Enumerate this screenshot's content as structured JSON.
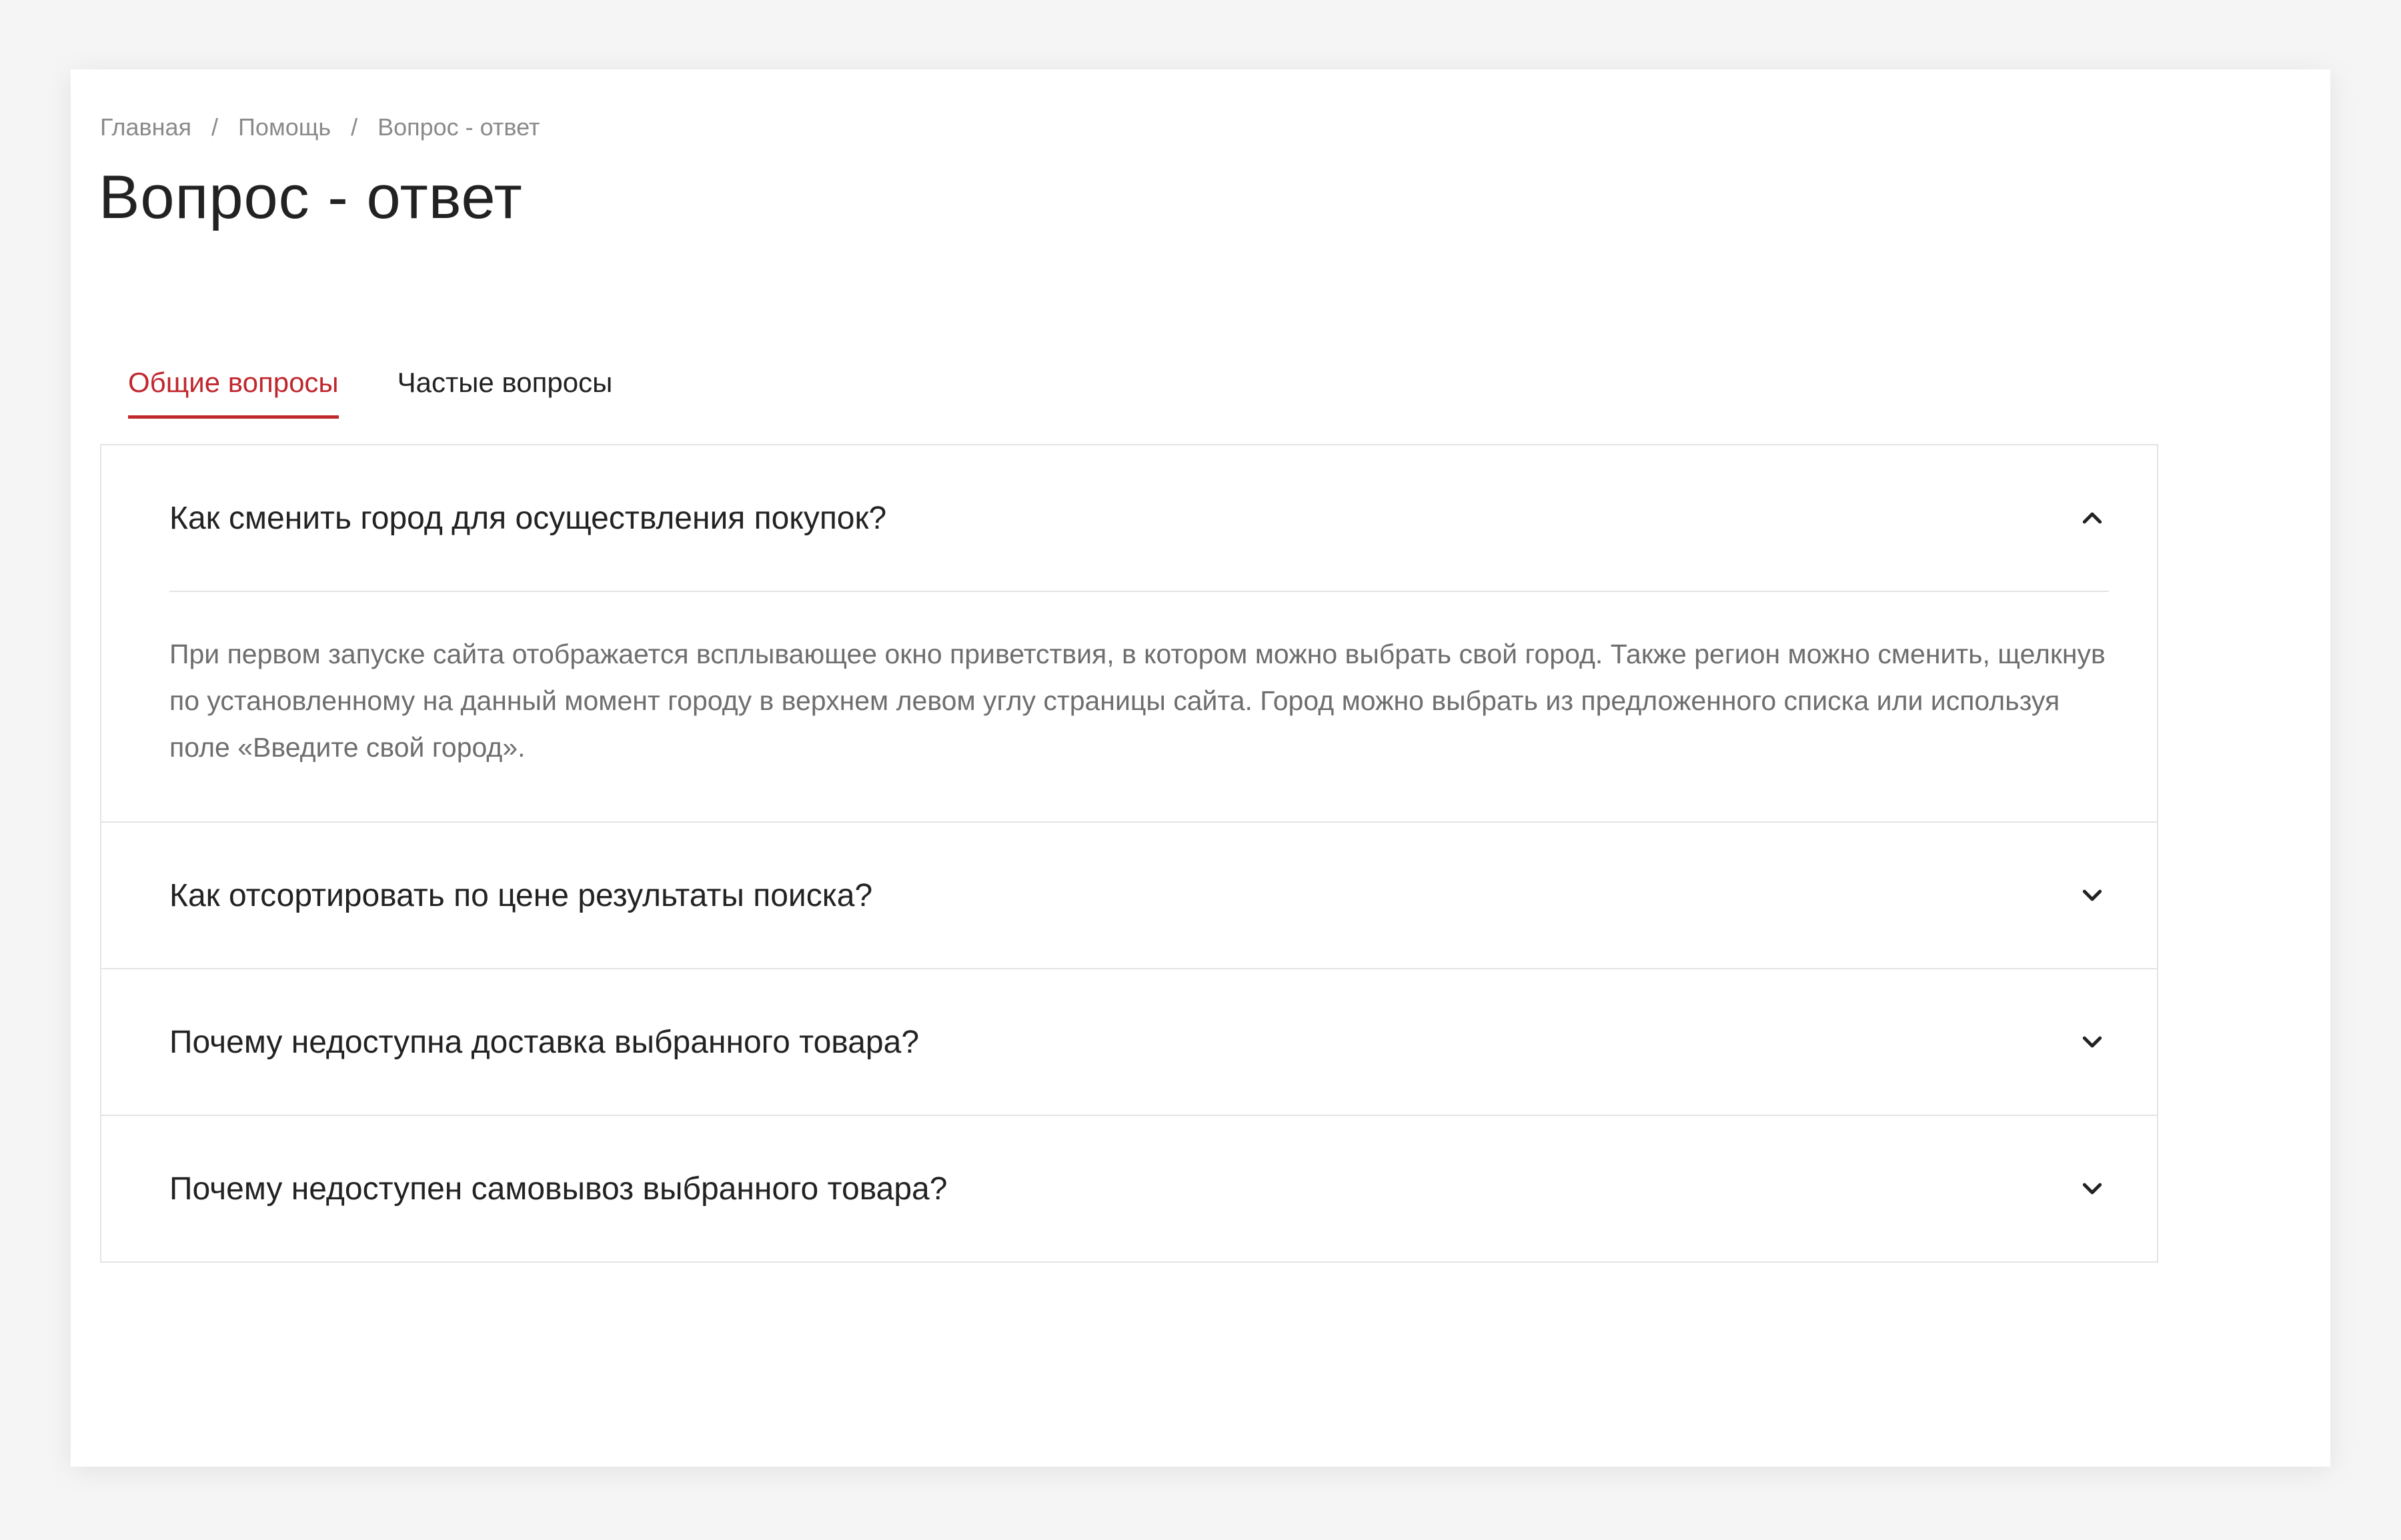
{
  "breadcrumb": {
    "items": [
      "Главная",
      "Помощь",
      "Вопрос - ответ"
    ],
    "separator": "/"
  },
  "page": {
    "title": "Вопрос - ответ"
  },
  "tabs": [
    {
      "label": "Общие вопросы",
      "active": true
    },
    {
      "label": "Частые вопросы",
      "active": false
    }
  ],
  "faq": [
    {
      "question": "Как сменить город для осуществления покупок?",
      "answer": "При первом запуске сайта отображается всплывающее окно приветствия, в котором можно выбрать свой город. Также регион можно сменить, щелкнув по установленному на данный момент городу в верхнем левом углу страницы сайта. Город можно выбрать из предложенного списка или используя поле «Введите свой город».",
      "expanded": true,
      "icon": "chevron-up-icon"
    },
    {
      "question": "Как отсортировать по цене результаты поиска?",
      "expanded": false,
      "icon": "chevron-down-icon"
    },
    {
      "question": "Почему недоступна доставка выбранного товара?",
      "expanded": false,
      "icon": "chevron-down-icon"
    },
    {
      "question": "Почему недоступен самовывоз выбранного товара?",
      "expanded": false,
      "icon": "chevron-down-icon"
    }
  ],
  "colors": {
    "accent": "#c0272d",
    "text": "#222222",
    "muted": "#8a8a8a",
    "answer_text": "#6e6e6e",
    "border": "#e4e4e4",
    "page_bg": "#f5f5f5",
    "card_bg": "#ffffff"
  }
}
